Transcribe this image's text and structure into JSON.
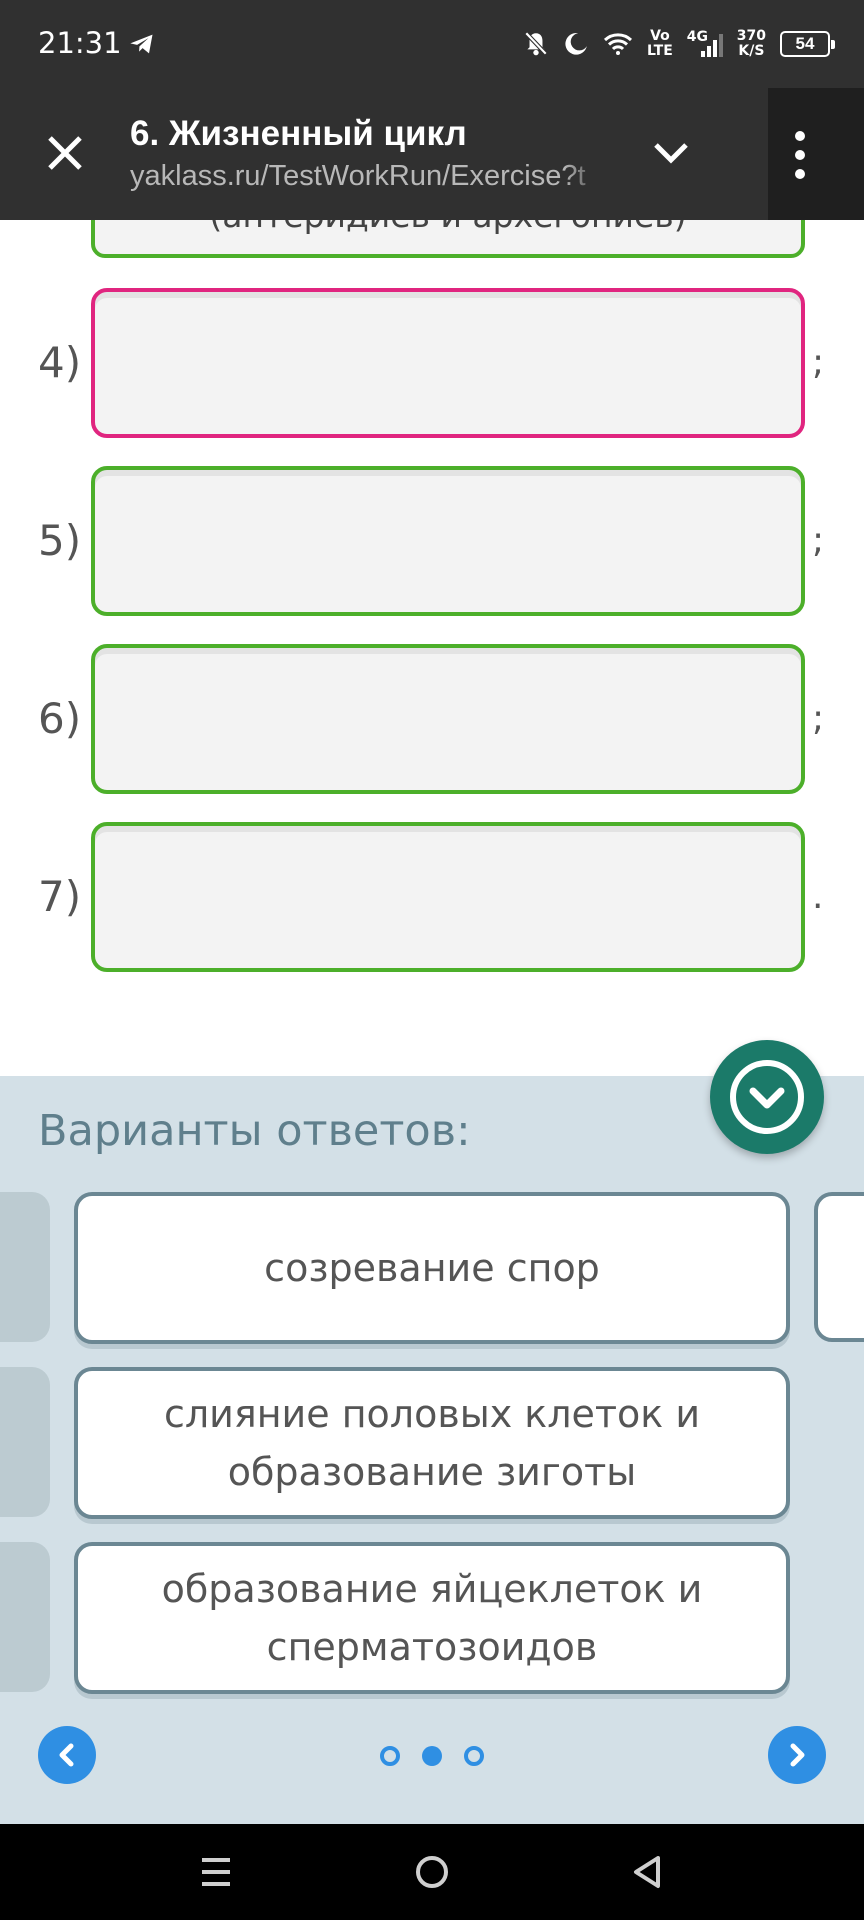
{
  "status_bar": {
    "time": "21:31",
    "network_label_top": "Vo",
    "network_label_bottom": "LTE",
    "network_type": "4G",
    "speed_top": "370",
    "speed_bottom": "K/S",
    "battery": "54",
    "icons": [
      "telegram-icon",
      "bell-off-icon",
      "moon-icon",
      "wifi-icon",
      "signal-icon",
      "battery-icon"
    ]
  },
  "browser": {
    "title": "6. Жизненный цикл",
    "url": "yaklass.ru/TestWorkRun/Exercise?t"
  },
  "task": {
    "partial_text": "(антеридиев и архегониев)",
    "slots": [
      {
        "number": "4)",
        "punct": ";",
        "active": true
      },
      {
        "number": "5)",
        "punct": ";",
        "active": false
      },
      {
        "number": "6)",
        "punct": ";",
        "active": false
      },
      {
        "number": "7)",
        "punct": ".",
        "active": false
      }
    ]
  },
  "variants": {
    "title": "Варианты ответов:",
    "cards": [
      {
        "text": "созревание спор"
      },
      {
        "text": "слияние половых клеток и образование зиготы"
      },
      {
        "text": "образование яйцеклеток и сперматозоидов"
      }
    ],
    "pages": 3,
    "current_page": 2
  },
  "colors": {
    "slot_border": "#4caf2a",
    "slot_active_border": "#e0257f",
    "panel_bg": "#d3e0e7",
    "accent_blue": "#2f8fe3",
    "check_fab": "#1b7a69"
  }
}
